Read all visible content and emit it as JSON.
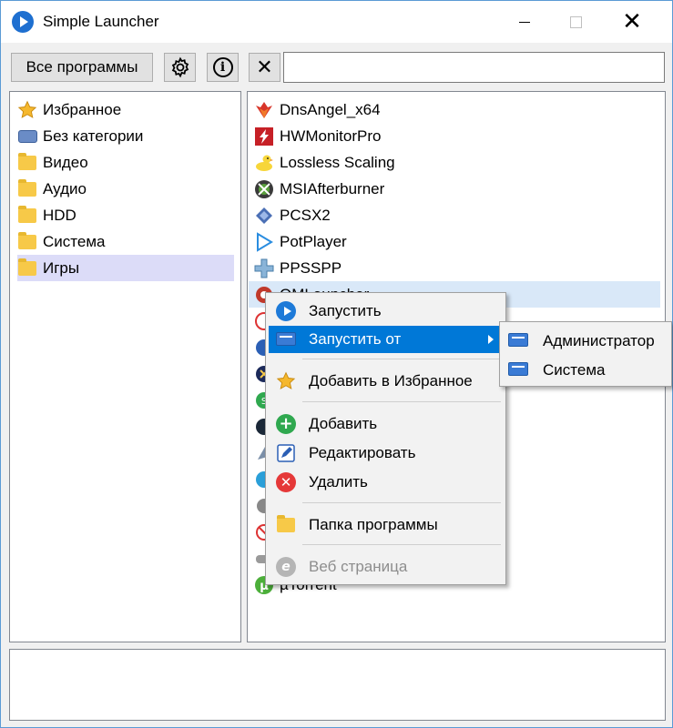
{
  "window": {
    "title": "Simple Launcher",
    "controls": {
      "minimize": "—",
      "maximize": "☐",
      "close": "✕"
    }
  },
  "toolbar": {
    "all_programs_label": "Все программы",
    "settings_icon": "gear-icon",
    "info_icon": "info-icon",
    "clear_label": "✕",
    "search_value": ""
  },
  "categories": [
    {
      "label": "Избранное",
      "icon": "star-icon"
    },
    {
      "label": "Без категории",
      "icon": "category-icon"
    },
    {
      "label": "Видео",
      "icon": "folder-icon"
    },
    {
      "label": "Аудио",
      "icon": "folder-icon"
    },
    {
      "label": "HDD",
      "icon": "folder-icon"
    },
    {
      "label": "Система",
      "icon": "folder-icon"
    },
    {
      "label": "Игры",
      "icon": "folder-icon",
      "selected": true
    }
  ],
  "programs": [
    {
      "label": "DnsAngel_x64",
      "icon": "dnsangel-icon"
    },
    {
      "label": "HWMonitorPro",
      "icon": "hwmonitor-icon"
    },
    {
      "label": "Lossless Scaling",
      "icon": "duck-icon"
    },
    {
      "label": "MSIAfterburner",
      "icon": "afterburner-icon"
    },
    {
      "label": "PCSX2",
      "icon": "pcsx2-icon"
    },
    {
      "label": "PotPlayer",
      "icon": "potplayer-icon"
    },
    {
      "label": "PPSSPP",
      "icon": "ppsspp-icon"
    },
    {
      "label": "QMLauncher",
      "icon": "app-icon",
      "hovered": true
    },
    {
      "label": "",
      "icon": "app-icon"
    },
    {
      "label": "",
      "icon": "app-icon"
    },
    {
      "label": "",
      "icon": "app-icon"
    },
    {
      "label": "",
      "icon": "app-icon"
    },
    {
      "label": "",
      "icon": "app-icon"
    },
    {
      "label": "",
      "icon": "app-icon"
    },
    {
      "label": "",
      "icon": "app-icon"
    },
    {
      "label": "",
      "icon": "app-icon"
    },
    {
      "label": "",
      "icon": "app-icon"
    },
    {
      "label": "",
      "icon": "app-icon"
    },
    {
      "label": "µTorrent",
      "icon": "utorrent-icon"
    }
  ],
  "context_menu": {
    "run": "Запустить",
    "run_as": "Запустить от",
    "add_favorite": "Добавить в Избранное",
    "add": "Добавить",
    "edit": "Редактировать",
    "delete": "Удалить",
    "program_folder": "Папка программы",
    "web_page": "Веб страница"
  },
  "submenu": {
    "administrator": "Администратор",
    "system": "Система"
  },
  "colors": {
    "menu_highlight": "#0078d7",
    "category_selected": "#dcdcf8",
    "program_hover": "#d9e8f8"
  }
}
